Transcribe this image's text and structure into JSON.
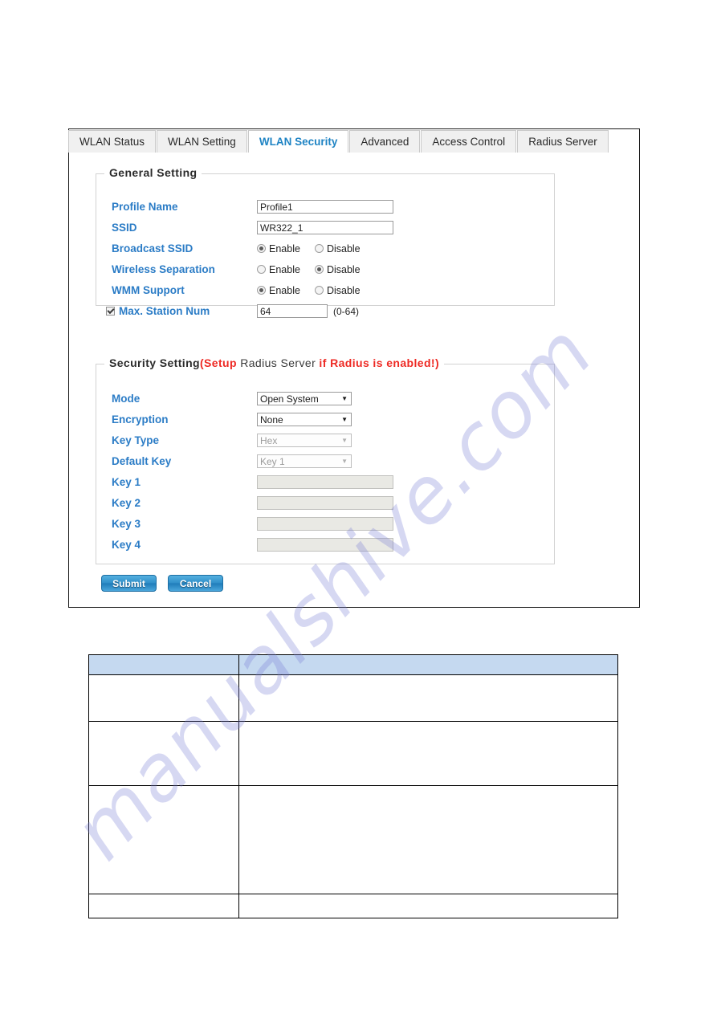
{
  "tabs": [
    {
      "label": "WLAN Status",
      "active": false
    },
    {
      "label": "WLAN Setting",
      "active": false
    },
    {
      "label": "WLAN Security",
      "active": true
    },
    {
      "label": "Advanced",
      "active": false
    },
    {
      "label": "Access Control",
      "active": false
    },
    {
      "label": "Radius Server",
      "active": false
    }
  ],
  "general": {
    "legend": "General Setting",
    "profile_name": {
      "label": "Profile Name",
      "value": "Profile1"
    },
    "ssid": {
      "label": "SSID",
      "value": "WR322_1"
    },
    "broadcast_ssid": {
      "label": "Broadcast SSID",
      "enable_label": "Enable",
      "disable_label": "Disable",
      "selected": "Enable"
    },
    "wireless_separation": {
      "label": "Wireless Separation",
      "enable_label": "Enable",
      "disable_label": "Disable",
      "selected": "Disable"
    },
    "wmm_support": {
      "label": "WMM Support",
      "enable_label": "Enable",
      "disable_label": "Disable",
      "selected": "Enable"
    },
    "max_station_num": {
      "label": "Max. Station Num",
      "checked": true,
      "value": "64",
      "hint": "(0-64)"
    }
  },
  "security": {
    "legend_main": "Security Setting",
    "legend_paren_open": "(",
    "legend_setup": "Setup",
    "legend_radius_server": " Radius Server ",
    "legend_if_enabled": "if Radius is enabled!)",
    "mode": {
      "label": "Mode",
      "value": "Open System",
      "disabled": false
    },
    "encryption": {
      "label": "Encryption",
      "value": "None",
      "disabled": false
    },
    "key_type": {
      "label": "Key Type",
      "value": "Hex",
      "disabled": true
    },
    "default_key": {
      "label": "Default Key",
      "value": "Key 1",
      "disabled": true
    },
    "key1": {
      "label": "Key 1",
      "value": "",
      "disabled": true
    },
    "key2": {
      "label": "Key 2",
      "value": "",
      "disabled": true
    },
    "key3": {
      "label": "Key 3",
      "value": "",
      "disabled": true
    },
    "key4": {
      "label": "Key 4",
      "value": "",
      "disabled": true
    }
  },
  "buttons": {
    "submit": "Submit",
    "cancel": "Cancel"
  },
  "description_table": {
    "header": [
      "",
      ""
    ],
    "rows": [
      [
        "",
        ""
      ],
      [
        "",
        ""
      ],
      [
        "",
        ""
      ],
      [
        "",
        ""
      ]
    ]
  },
  "watermark": {
    "text": "manualshive.com"
  },
  "colors": {
    "label_blue": "#2b7cc6",
    "tab_active_blue": "#1f84c4",
    "warning_red": "#ee2a24",
    "table_header_blue": "#c5d9f0",
    "button_blue": "#2f8fc9"
  }
}
